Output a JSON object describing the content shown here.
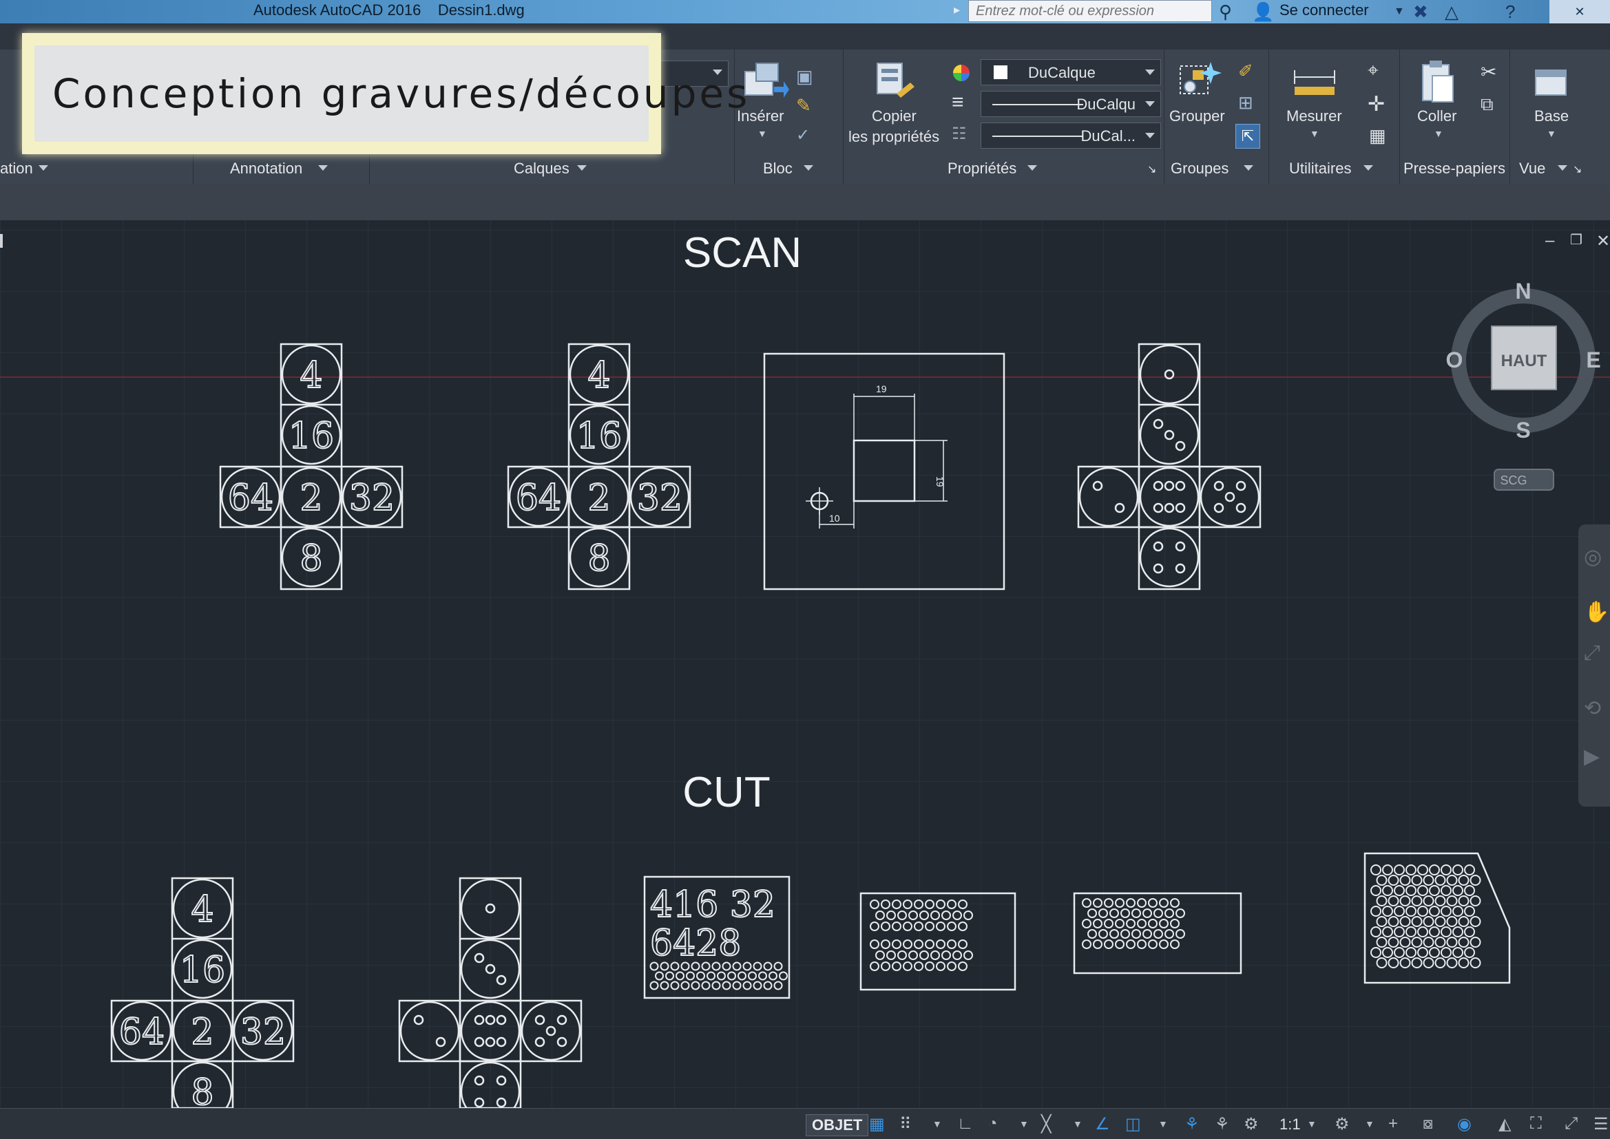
{
  "titlebar": {
    "title": "Autodesk AutoCAD 2016    Dessin1.dwg",
    "search_placeholder": "Entrez mot-clé ou expression",
    "signin_label": "Se connecter"
  },
  "banner": {
    "text": "Conception gravures/découpes"
  },
  "ribbon": {
    "left_panel_label": "ation",
    "annotation_label": "Annotation",
    "calques_label": "Calques",
    "bloc": {
      "insert_label": "Insérer",
      "panel_label": "Bloc"
    },
    "proprietes": {
      "copy_label_line1": "Copier",
      "copy_label_line2": "les propriétés",
      "color_value": "DuCalque",
      "linetype_value": "DuCalqu",
      "lineweight_value": "DuCal...",
      "panel_label": "Propriétés"
    },
    "groupes": {
      "group_label": "Grouper",
      "panel_label": "Groupes"
    },
    "utilitaires": {
      "measure_label": "Mesurer",
      "panel_label": "Utilitaires"
    },
    "presse_papiers": {
      "paste_label": "Coller",
      "panel_label": "Presse-papiers"
    },
    "vue": {
      "base_label": "Base",
      "panel_label": "Vue"
    }
  },
  "drawing": {
    "scan_title": "SCAN",
    "cut_title": "CUT",
    "dice_numbers_face": {
      "top": "4",
      "upper": "16",
      "left": "64",
      "center": "2",
      "right": "32",
      "bottom": "8"
    },
    "dimension_labels": {
      "width": "19",
      "height": "19",
      "offset": "10"
    },
    "cut_number_plate_line1": "416 32",
    "cut_number_plate_line2": "6428"
  },
  "viewcube": {
    "north": "N",
    "south": "S",
    "east": "E",
    "west": "O",
    "face": "HAUT",
    "wcs": "SCG"
  },
  "statusbar": {
    "model_label": "OBJET",
    "scale_label": "1:1"
  },
  "colors": {
    "background": "#212830",
    "ribbon": "#3c4450",
    "linework": "#e9ecef",
    "banner": "#f5f1c6"
  }
}
